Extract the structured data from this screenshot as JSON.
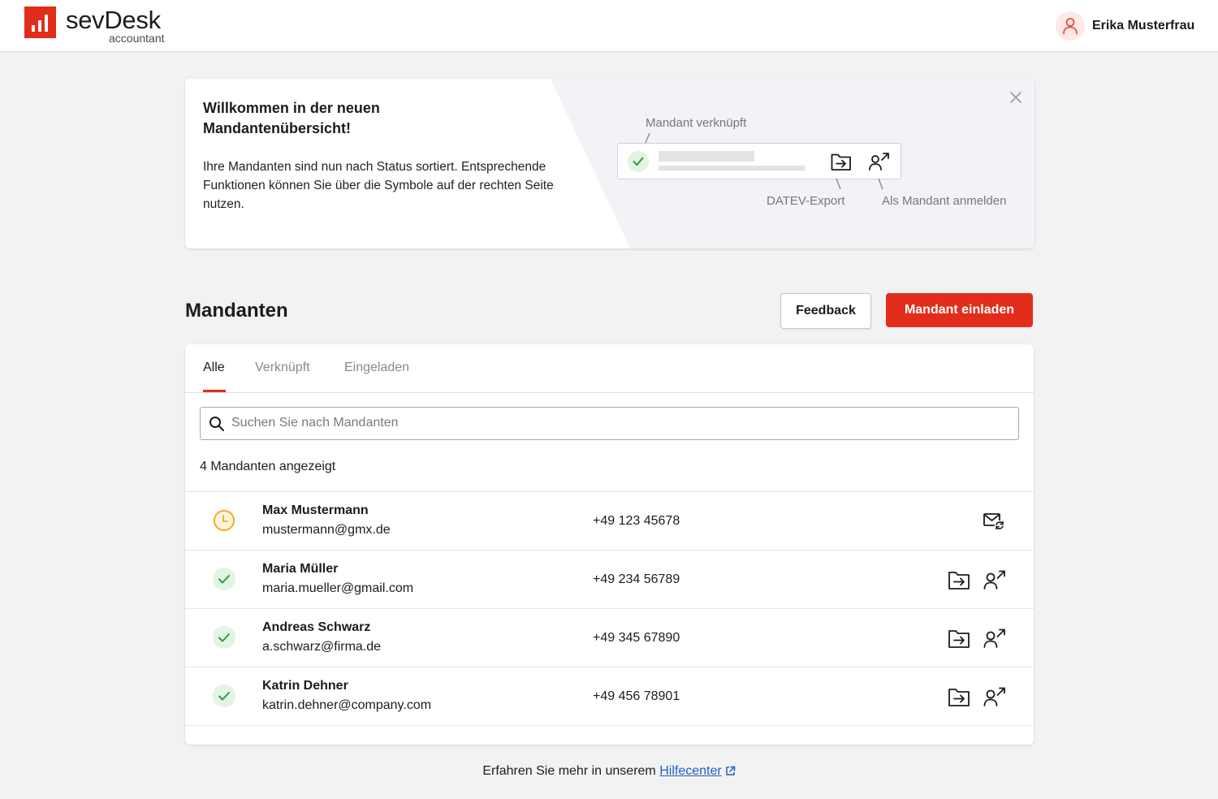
{
  "app": {
    "logo_text": "sevDesk",
    "logo_sub": "accountant",
    "user_name": "Erika Musterfrau"
  },
  "banner": {
    "title": "Willkommen in der neuen Mandantenübersicht!",
    "text": "Ihre Mandanten sind nun nach Status sortiert. Entsprechende Funktionen können Sie über die Symbole auf der rechten Seite nutzen.",
    "label_linked": "Mandant verknüpft",
    "label_export": "DATEV-Export",
    "label_login": "Als Mandant anmelden"
  },
  "section": {
    "title": "Mandanten",
    "feedback_label": "Feedback",
    "invite_label": "Mandant einladen"
  },
  "tabs": [
    {
      "label": "Alle",
      "active": true
    },
    {
      "label": "Verknüpft",
      "active": false
    },
    {
      "label": "Eingeladen",
      "active": false
    }
  ],
  "search": {
    "placeholder": "Suchen Sie nach Mandanten",
    "value": ""
  },
  "count_text": "4 Mandanten angezeigt",
  "clients": [
    {
      "name": "Max Mustermann",
      "email": "mustermann@gmx.de",
      "phone": "+49 123 45678",
      "status": "pending",
      "actions": [
        "resend-invite"
      ]
    },
    {
      "name": "Maria Müller",
      "email": "maria.mueller@gmail.com",
      "phone": "+49 234 56789",
      "status": "linked",
      "actions": [
        "datev-export",
        "login-as-client"
      ]
    },
    {
      "name": "Andreas Schwarz",
      "email": "a.schwarz@firma.de",
      "phone": "+49 345 67890",
      "status": "linked",
      "actions": [
        "datev-export",
        "login-as-client"
      ]
    },
    {
      "name": "Katrin Dehner",
      "email": "katrin.dehner@company.com",
      "phone": "+49 456 78901",
      "status": "linked",
      "actions": [
        "datev-export",
        "login-as-client"
      ]
    }
  ],
  "footer": {
    "text": "Erfahren Sie mehr in unserem",
    "link": "Hilfecenter"
  },
  "colors": {
    "brand": "#e22d1b",
    "linked": "#2e9b3a",
    "pending": "#f0a820",
    "link": "#1f5fc2"
  },
  "icons": {
    "status_linked": "check-icon",
    "status_pending": "clock-icon",
    "datev_export": "folder-export-icon",
    "login_as_client": "user-arrow-icon",
    "resend_invite": "mail-refresh-icon"
  }
}
